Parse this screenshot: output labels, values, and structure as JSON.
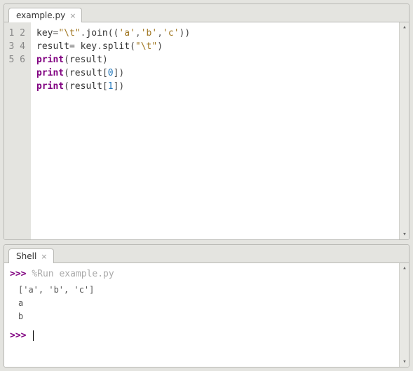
{
  "editor": {
    "tab_label": "example.py",
    "lines": [
      "1",
      "2",
      "3",
      "4",
      "5",
      "6"
    ],
    "code": [
      [
        {
          "t": "key",
          "c": "s-name"
        },
        {
          "t": "=",
          "c": "s-op"
        },
        {
          "t": "\"\\t\"",
          "c": "s-str"
        },
        {
          "t": ".",
          "c": "s-op"
        },
        {
          "t": "join",
          "c": "s-name"
        },
        {
          "t": "((",
          "c": "s-paren"
        },
        {
          "t": "'a'",
          "c": "s-str"
        },
        {
          "t": ",",
          "c": "s-op"
        },
        {
          "t": "'b'",
          "c": "s-str"
        },
        {
          "t": ",",
          "c": "s-op"
        },
        {
          "t": "'c'",
          "c": "s-str"
        },
        {
          "t": "))",
          "c": "s-paren"
        }
      ],
      [
        {
          "t": "result",
          "c": "s-name"
        },
        {
          "t": "= ",
          "c": "s-op"
        },
        {
          "t": "key",
          "c": "s-name"
        },
        {
          "t": ".",
          "c": "s-op"
        },
        {
          "t": "split",
          "c": "s-name"
        },
        {
          "t": "(",
          "c": "s-paren"
        },
        {
          "t": "\"\\t\"",
          "c": "s-str"
        },
        {
          "t": ")",
          "c": "s-paren"
        }
      ],
      [
        {
          "t": "print",
          "c": "s-kw"
        },
        {
          "t": "(",
          "c": "s-paren"
        },
        {
          "t": "result",
          "c": "s-name"
        },
        {
          "t": ")",
          "c": "s-paren"
        }
      ],
      [
        {
          "t": "print",
          "c": "s-kw"
        },
        {
          "t": "(",
          "c": "s-paren"
        },
        {
          "t": "result",
          "c": "s-name"
        },
        {
          "t": "[",
          "c": "s-paren"
        },
        {
          "t": "0",
          "c": "s-num"
        },
        {
          "t": "])",
          "c": "s-paren"
        }
      ],
      [
        {
          "t": "print",
          "c": "s-kw"
        },
        {
          "t": "(",
          "c": "s-paren"
        },
        {
          "t": "result",
          "c": "s-name"
        },
        {
          "t": "[",
          "c": "s-paren"
        },
        {
          "t": "1",
          "c": "s-num"
        },
        {
          "t": "])",
          "c": "s-paren"
        }
      ],
      []
    ]
  },
  "shell": {
    "tab_label": "Shell",
    "prompt": ">>>",
    "run_cmd": "%Run example.py",
    "output": [
      "['a', 'b', 'c']",
      "a",
      "b"
    ]
  }
}
